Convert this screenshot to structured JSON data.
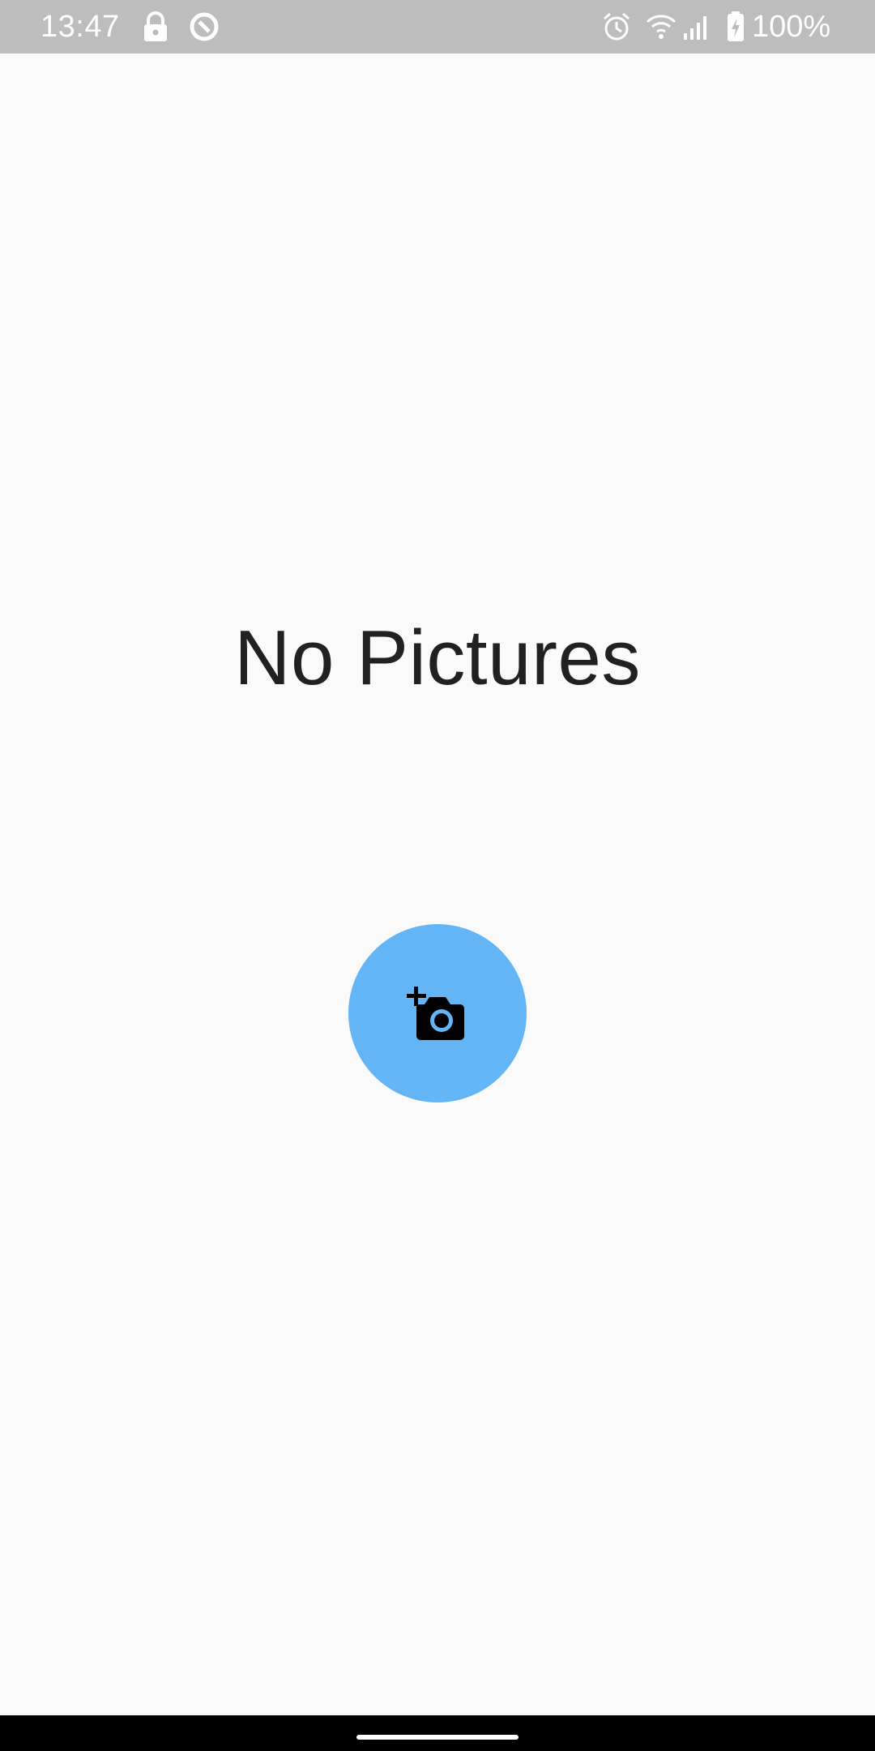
{
  "status_bar": {
    "time": "13:47",
    "battery": "100%",
    "icons": [
      "lock-icon",
      "data-saver-icon",
      "alarm-icon",
      "wifi-icon",
      "signal-icon",
      "battery-charging-icon"
    ]
  },
  "main": {
    "empty_text": "No Pictures"
  },
  "fab": {
    "icon": "add-a-photo-icon",
    "color": "#64b5f6"
  },
  "navigation": {
    "handle": "home-gesture-handle"
  }
}
